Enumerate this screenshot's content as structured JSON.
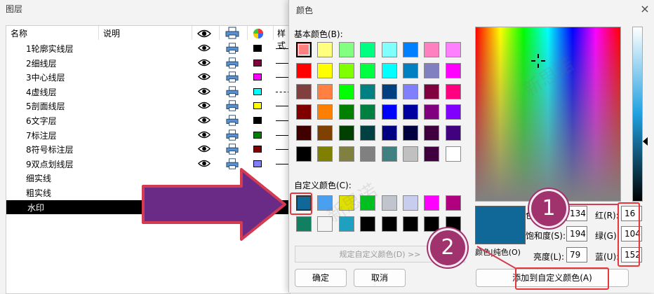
{
  "layer_window": {
    "title": "图层",
    "columns": {
      "name": "名称",
      "desc": "说明",
      "style": "样式"
    },
    "rows": [
      {
        "name": "1轮廓实线层",
        "color": "#000000",
        "line": "solid"
      },
      {
        "name": "2细线层",
        "color": "#800040",
        "line": "solid"
      },
      {
        "name": "3中心线层",
        "color": "#ff00ff",
        "line": "solid"
      },
      {
        "name": "4虚线层",
        "color": "#00ffff",
        "line": "dashed"
      },
      {
        "name": "5剖面线层",
        "color": "#ffff00",
        "line": "solid"
      },
      {
        "name": "6文字层",
        "color": "#000000",
        "line": "solid"
      },
      {
        "name": "7标注层",
        "color": "#008000",
        "line": "solid"
      },
      {
        "name": "8符号标注层",
        "color": "#800000",
        "line": "solid"
      },
      {
        "name": "9双点划线层",
        "color": "#8080ff",
        "line": "solid"
      },
      {
        "name": "细实线",
        "color": "",
        "line": ""
      },
      {
        "name": "粗实线",
        "color": "",
        "line": ""
      },
      {
        "name": "水印",
        "color": "",
        "line": ""
      }
    ],
    "selected_row": "水印"
  },
  "color_dialog": {
    "title": "颜色",
    "close": "×",
    "basic_label": "基本颜色(B):",
    "basic_colors": [
      "#ff8080",
      "#ffff80",
      "#80ff80",
      "#00ff80",
      "#80ffff",
      "#0080ff",
      "#ff80c0",
      "#ff80ff",
      "#ff0000",
      "#ffff00",
      "#80ff00",
      "#00ff40",
      "#00ffff",
      "#0080c0",
      "#8080c0",
      "#ff00ff",
      "#804040",
      "#ff8040",
      "#00ff00",
      "#008080",
      "#004080",
      "#8080ff",
      "#800040",
      "#ff0080",
      "#800000",
      "#ff8000",
      "#008000",
      "#008040",
      "#0000ff",
      "#0000a0",
      "#800080",
      "#8000ff",
      "#400000",
      "#804000",
      "#004000",
      "#004040",
      "#000080",
      "#000040",
      "#400040",
      "#400080",
      "#000000",
      "#808000",
      "#808040",
      "#808080",
      "#408080",
      "#c0c0c0",
      "#400040",
      "#ffffff"
    ],
    "custom_label": "自定义颜色(C):",
    "custom_colors": [
      "#106898",
      "#4aa0f0",
      "#e0e000",
      "#00c020",
      "#c0c4cc",
      "#c8cdee",
      "#ff00ff",
      "#b00080",
      "#108060",
      "#f4f4f4",
      "#20a0c0",
      "#000000",
      "#000000",
      "#000000",
      "#000000",
      "#000000"
    ],
    "define_button": "规定自定义颜色(D) >>",
    "ok_button": "确定",
    "cancel_button": "取消",
    "add_button": "添加到自定义颜色(A)",
    "preview_color": "#106898",
    "solid_label": "颜色|纯色(O)",
    "hue_label": "色调(E):",
    "hue_value": "134",
    "sat_label": "饱和度(S):",
    "sat_value": "194",
    "lum_label": "亮度(L):",
    "lum_value": "79",
    "red_label": "红(R):",
    "red_value": "16",
    "green_label": "绿(G):",
    "green_value": "104",
    "blue_label": "蓝(U):",
    "blue_value": "152"
  },
  "annotations": {
    "badge1": "1",
    "badge2": "2"
  },
  "colors": {
    "accent_red": "#e8363d",
    "badge": "#a0326e",
    "arrow": "#6a2b86"
  }
}
